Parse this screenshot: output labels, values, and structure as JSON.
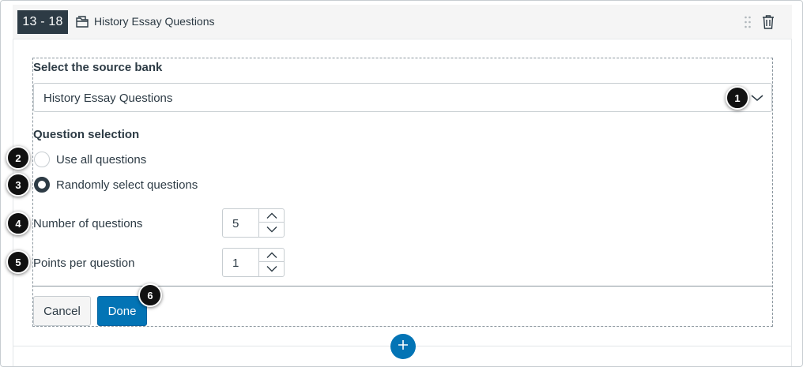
{
  "header": {
    "range": "13 - 18",
    "title": "History Essay Questions"
  },
  "source": {
    "label": "Select the source bank",
    "selected": "History Essay Questions"
  },
  "selection": {
    "label": "Question selection",
    "options": [
      {
        "label": "Use all questions",
        "checked": false
      },
      {
        "label": "Randomly select questions",
        "checked": true
      }
    ]
  },
  "fields": {
    "num_questions": {
      "label": "Number of questions",
      "value": "5"
    },
    "points_per_question": {
      "label": "Points per question",
      "value": "1"
    }
  },
  "buttons": {
    "cancel": "Cancel",
    "done": "Done"
  },
  "callouts": [
    "1",
    "2",
    "3",
    "4",
    "5",
    "6"
  ],
  "colors": {
    "primary": "#0374b5",
    "text": "#2d3b45",
    "badge": "#2d3b45"
  },
  "icons": {
    "bank": "question-bank-icon",
    "drag": "drag-handle-icon",
    "delete": "trash-icon",
    "chevron": "chevron-down-icon",
    "add": "plus-icon"
  }
}
